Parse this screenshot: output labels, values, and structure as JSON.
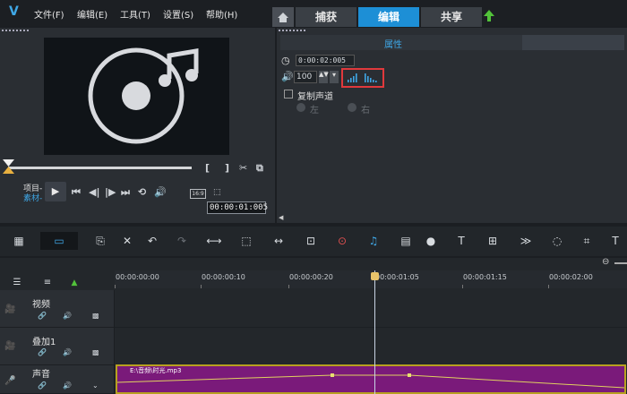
{
  "app": {
    "logo": "V"
  },
  "menu": {
    "file": "文件(F)",
    "edit": "编辑(E)",
    "tools": "工具(T)",
    "settings": "设置(S)",
    "help": "帮助(H)"
  },
  "tabs": {
    "capture": "捕获",
    "edit": "编辑",
    "share": "共享"
  },
  "preview": {
    "mode_project": "项目-",
    "mode_clip": "素材-",
    "aspect": "16:9",
    "timecode": "00:00:01:005"
  },
  "attributes": {
    "title": "属性",
    "duration": "0:00:02:005",
    "volume": "100",
    "duplicate_channel": "复制声道",
    "left": "左",
    "right": "右"
  },
  "ruler": {
    "labels": [
      "00:00:00:00",
      "00:00:00:10",
      "00:00:00:20",
      "00:00:01:05",
      "00:00:01:15",
      "00:00:02:00"
    ]
  },
  "tracks": [
    {
      "name": "视频"
    },
    {
      "name": "叠加1"
    },
    {
      "name": "声音"
    }
  ],
  "clip": {
    "name": "E:\\音频\\时光.mp3"
  },
  "colors": {
    "accent": "#1d8fd6",
    "clip": "#7a1a7a",
    "highlight": "#e0393c"
  }
}
